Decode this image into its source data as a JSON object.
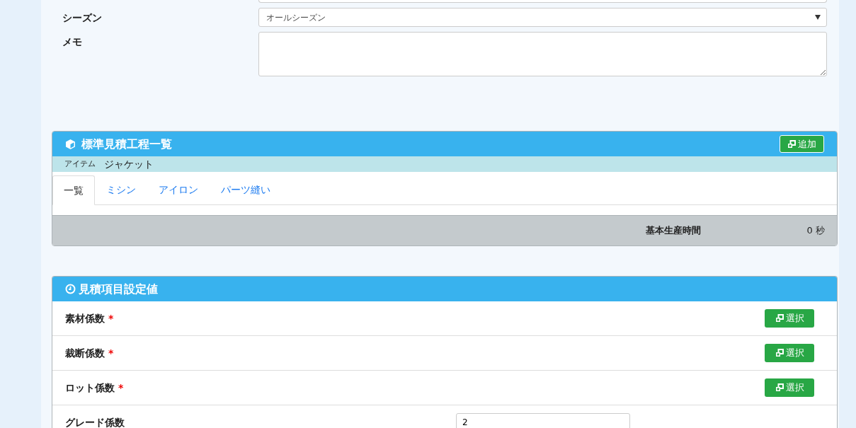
{
  "form_fields": [
    {
      "label": "シーズン",
      "kind": "select",
      "value": "オールシーズン"
    },
    {
      "label": "メモ",
      "kind": "textarea"
    }
  ],
  "process_panel": {
    "title": "標準見積工程一覧",
    "add_button": "追加",
    "item_label": "アイテム",
    "item_value": "ジャケット",
    "tabs": [
      {
        "label": "一覧",
        "selected": true
      },
      {
        "label": "ミシン",
        "selected": false
      },
      {
        "label": "アイロン",
        "selected": false
      },
      {
        "label": "パーツ縫い",
        "selected": false
      }
    ],
    "footer_label": "基本生産時間",
    "footer_value": "0 秒"
  },
  "settings_panel": {
    "title": "見積項目設定値",
    "rows": [
      {
        "label": "素材係数",
        "required_mark": "*",
        "kind": "button",
        "button": "選択"
      },
      {
        "label": "裁断係数",
        "required_mark": "*",
        "kind": "button",
        "button": "選択"
      },
      {
        "label": "ロット係数",
        "required_mark": "*",
        "kind": "button",
        "button": "選択"
      },
      {
        "label": "グレード係数",
        "kind": "input",
        "value": "2"
      }
    ]
  }
}
